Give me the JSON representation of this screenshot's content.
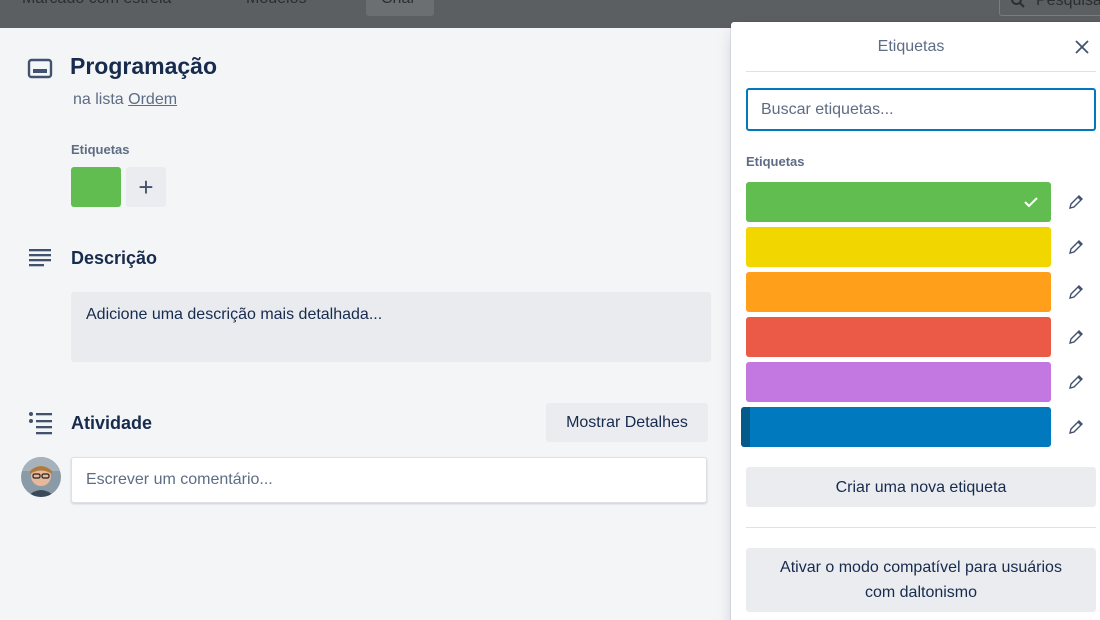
{
  "topbar": {
    "nav_items": [
      "Marcado com estrela",
      "Modelos"
    ],
    "create_label": "Criar",
    "search_label": "Pesquisar"
  },
  "card": {
    "title": "Programação",
    "list_prefix": "na lista",
    "list_name": "Ordem",
    "labels_heading": "Etiquetas",
    "add_label": "+",
    "applied_label_color": "#61bd4f",
    "description_heading": "Descrição",
    "description_placeholder": "Adicione uma descrição mais detalhada...",
    "activity_heading": "Atividade",
    "show_details_label": "Mostrar Detalhes",
    "comment_placeholder": "Escrever um comentário..."
  },
  "popover": {
    "title": "Etiquetas",
    "search_placeholder": "Buscar etiquetas...",
    "labels_heading": "Etiquetas",
    "labels": [
      {
        "color": "#61bd4f",
        "selected": true
      },
      {
        "color": "#f2d600",
        "selected": false
      },
      {
        "color": "#ff9f1a",
        "selected": false
      },
      {
        "color": "#eb5a46",
        "selected": false
      },
      {
        "color": "#c377e0",
        "selected": false
      },
      {
        "color": "#0079bf",
        "selected": false
      }
    ],
    "create_label": "Criar uma nova etiqueta",
    "colorblind_line1": "Ativar o modo compatível para usuários",
    "colorblind_line2": "com daltonismo"
  }
}
